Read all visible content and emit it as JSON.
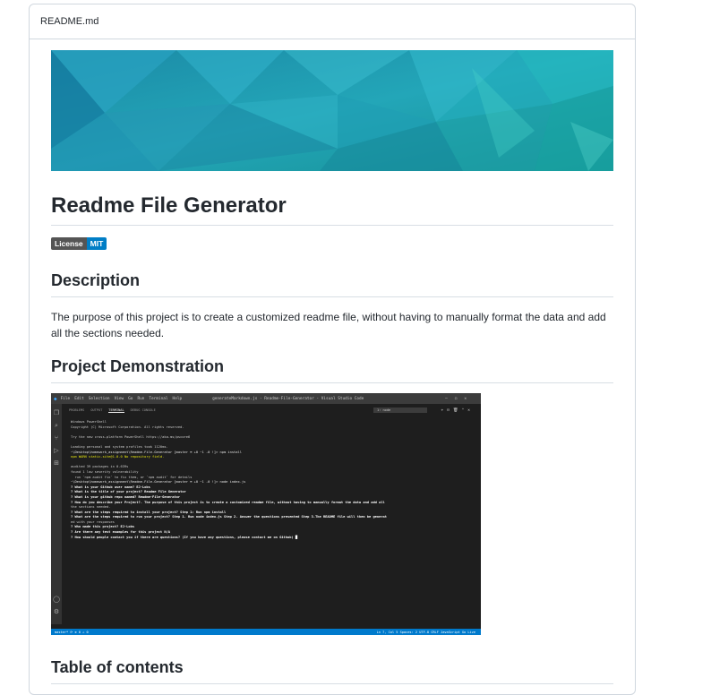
{
  "file": {
    "name": "README.md"
  },
  "readme": {
    "title": "Readme File Generator",
    "badge": {
      "label": "License",
      "value": "MIT"
    },
    "description": {
      "heading": "Description",
      "text": "The purpose of this project is to create a customized readme file, without having to manually format the data and add all the sections needed."
    },
    "demo": {
      "heading": "Project Demonstration"
    },
    "toc": {
      "heading": "Table of contents"
    }
  },
  "vscode": {
    "menu": [
      "File",
      "Edit",
      "Selection",
      "View",
      "Go",
      "Run",
      "Terminal",
      "Help"
    ],
    "window_title": "generateMarkdown.js - Readme-File-Generator - Visual Studio Code",
    "panel_tabs": [
      "PROBLEMS",
      "OUTPUT",
      "TERMINAL",
      "DEBUG CONSOLE"
    ],
    "terminal_select": "1: node",
    "terminal_lines": [
      "Windows PowerShell",
      "Copyright (C) Microsoft Corporation. All rights reserved.",
      "",
      "Try the new cross-platform PowerShell https://aka.ms/pscore6",
      "",
      "Loading personal and system profiles took 1120ms.",
      "~\\Desktop\\homework_assignment\\Readme-File-Generator [master ≡ +0 ~1 -0 !]> npm install",
      "npm WARN static-site@1.0.0 No repository field.",
      "",
      "audited 39 packages in 0.639s",
      "found 1 low severity vulnerability",
      "  run `npm audit fix` to fix them, or `npm audit` for details",
      "~\\Desktop\\homework_assignment\\Readme-File-Generator [master ≡ +0 ~1 -0 !]> node index.js",
      "? What is your Github user name? EJ-Lobs",
      "? What is the title of your project? Readme File Generator",
      "? What is your github repo named? Readme-File-Generator",
      "? How do you describe your Project?. The purpose of this project is to create a customized readme file, without having to manually format the data and add all",
      "the sections needed.",
      "? What are the steps required to install your project? Step 1: Run npm install",
      "? What are the steps required to run your project? Step 1. Run node index.js Step 2. Answer the questions presented Step 3.The README file will then be generat",
      "ed with your responses",
      "? Who made this project? EJ-Lobs",
      "? Are there any test examples for this project N/A",
      "? How should people contact you if there are questions? (If you have any questions, please contact me on Github) █"
    ],
    "status_left": "master*  ⟳  ⊗ 0 ⚠ 0",
    "status_right": "Ln 7, Col 5   Spaces: 2   UTF-8   CRLF   JavaScript   Go Live"
  },
  "colors": {
    "banner_dark": "#1a7f9a",
    "banner_light": "#2ec4c8",
    "badge_label": "#555555",
    "badge_value": "#007ec6",
    "vscode_bg": "#1e1e1e",
    "vscode_status": "#007acc"
  }
}
